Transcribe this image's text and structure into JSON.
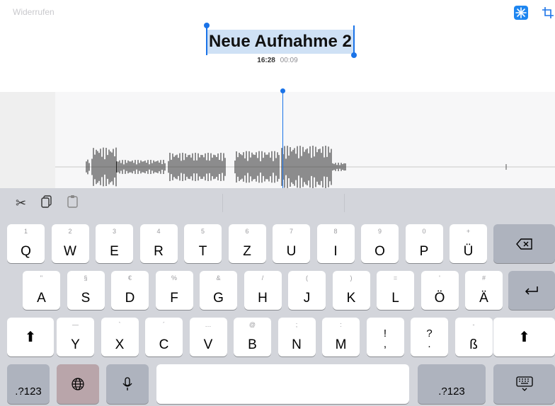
{
  "toolbar": {
    "undo_label": "Widerrufen"
  },
  "recording": {
    "title": "Neue Aufnahme 2",
    "time": "16:28",
    "duration": "00:09"
  },
  "edit_bar": {
    "cut_icon": "✂",
    "copy_icon": "⎘",
    "paste_icon": "📋"
  },
  "keyboard": {
    "row1": [
      {
        "main": "Q",
        "alt": "1"
      },
      {
        "main": "W",
        "alt": "2"
      },
      {
        "main": "E",
        "alt": "3"
      },
      {
        "main": "R",
        "alt": "4"
      },
      {
        "main": "T",
        "alt": "5"
      },
      {
        "main": "Z",
        "alt": "6"
      },
      {
        "main": "U",
        "alt": "7"
      },
      {
        "main": "I",
        "alt": "8"
      },
      {
        "main": "O",
        "alt": "9"
      },
      {
        "main": "P",
        "alt": "0"
      },
      {
        "main": "Ü",
        "alt": "+"
      }
    ],
    "row2": [
      {
        "main": "A",
        "alt": "\""
      },
      {
        "main": "S",
        "alt": "§"
      },
      {
        "main": "D",
        "alt": "€"
      },
      {
        "main": "F",
        "alt": "%"
      },
      {
        "main": "G",
        "alt": "&"
      },
      {
        "main": "H",
        "alt": "/"
      },
      {
        "main": "J",
        "alt": "("
      },
      {
        "main": "K",
        "alt": ")"
      },
      {
        "main": "L",
        "alt": "="
      },
      {
        "main": "Ö",
        "alt": "'"
      },
      {
        "main": "Ä",
        "alt": "#"
      }
    ],
    "row3": [
      {
        "main": "Y",
        "alt": "—"
      },
      {
        "main": "X",
        "alt": "`"
      },
      {
        "main": "C",
        "alt": "´"
      },
      {
        "main": "V",
        "alt": "…"
      },
      {
        "main": "B",
        "alt": "@"
      },
      {
        "main": "N",
        "alt": ";"
      },
      {
        "main": "M",
        "alt": ":"
      },
      {
        "main": "!\n,",
        "alt": ""
      },
      {
        "main": "?\n.",
        "alt": ""
      },
      {
        "main": "ß",
        "alt": "-"
      }
    ],
    "numbers_label": ".?123",
    "numbers_label_right": ".?123"
  }
}
